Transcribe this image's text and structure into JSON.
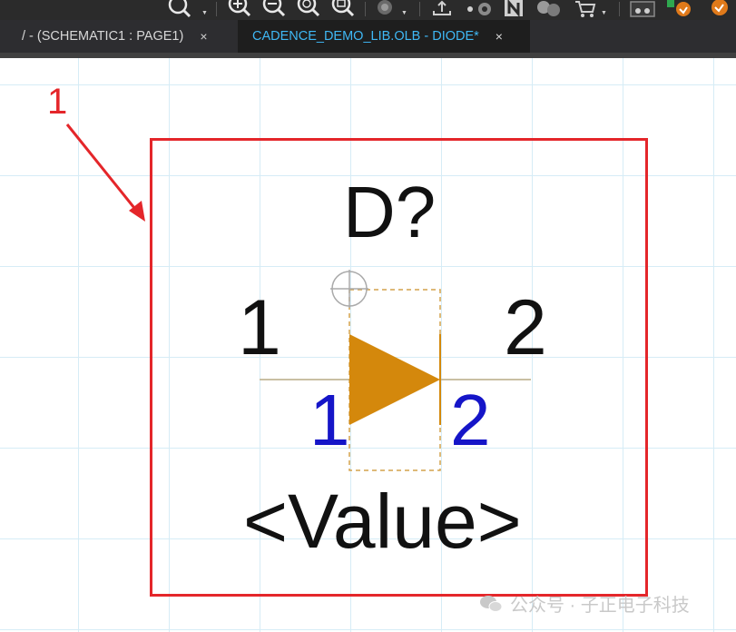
{
  "toolbar": {
    "icons": [
      "zoom-select-icon",
      "zoom-in-icon",
      "zoom-out-icon",
      "zoom-all-icon",
      "zoom-area-icon",
      "toggle-icon",
      "export-icon",
      "link-icon",
      "notes-icon",
      "design-icon",
      "cart-icon",
      "board-icon",
      "run-icon"
    ]
  },
  "tabs": [
    {
      "label": "/ - (SCHEMATIC1 : PAGE1)",
      "close": "×",
      "active": false
    },
    {
      "label": "CADENCE_DEMO_LIB.OLB - DIODE*",
      "close": "×",
      "active": true
    }
  ],
  "part": {
    "reference": "D?",
    "pin_names": [
      "1",
      "2"
    ],
    "pin_numbers": [
      "1",
      "2"
    ],
    "value": "<Value>"
  },
  "annotation": {
    "number": "1",
    "color": "#e4262a"
  },
  "watermark": {
    "text": "公众号 · 子正电子科技"
  },
  "colors": {
    "selection": "#e4262a",
    "diode_fill": "#d4880c",
    "pin_number": "#1515c8",
    "active_tab_text": "#3fb8f5",
    "grid": "#d6ecf6"
  }
}
